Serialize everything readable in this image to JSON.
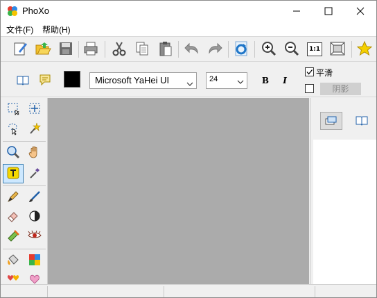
{
  "window": {
    "title": "PhoXo"
  },
  "menu": {
    "items": [
      "文件(F)",
      "帮助(H)"
    ]
  },
  "toolbar": {
    "buttons": [
      "new-icon",
      "open-icon",
      "save-icon",
      "print-icon",
      "cut-icon",
      "copy-icon",
      "paste-icon",
      "undo-icon",
      "redo-icon",
      "refresh-icon",
      "zoom-in-icon",
      "zoom-out-icon",
      "actual-size-icon",
      "fit-screen-icon",
      "favorite-icon"
    ],
    "actual_size_label": "1:1"
  },
  "text_options": {
    "color": "#000000",
    "font_family": "Microsoft YaHei UI",
    "font_size": "24",
    "bold_label": "B",
    "italic_label": "I",
    "antialias": {
      "label": "平滑",
      "checked": true
    },
    "shadow": {
      "label": "阴影",
      "checked": false
    }
  },
  "tools": [
    "rect-select-tool",
    "move-tool",
    "lasso-select-tool",
    "magic-wand-tool",
    "zoom-tool",
    "hand-tool",
    "text-tool",
    "eyedropper-tool",
    "pen-tool",
    "brush-tool",
    "eraser-tool",
    "contrast-tool",
    "stamp-tool",
    "red-eye-tool",
    "bucket-tool",
    "puzzle-tool",
    "heart-balloon-tool",
    "heart-tool"
  ],
  "active_tool": "text-tool",
  "colors": {
    "canvas": "#ababab",
    "accent": "#3c7fb1",
    "active_tool_bg": "#cde8ff",
    "text_tool": "#f5d800"
  }
}
